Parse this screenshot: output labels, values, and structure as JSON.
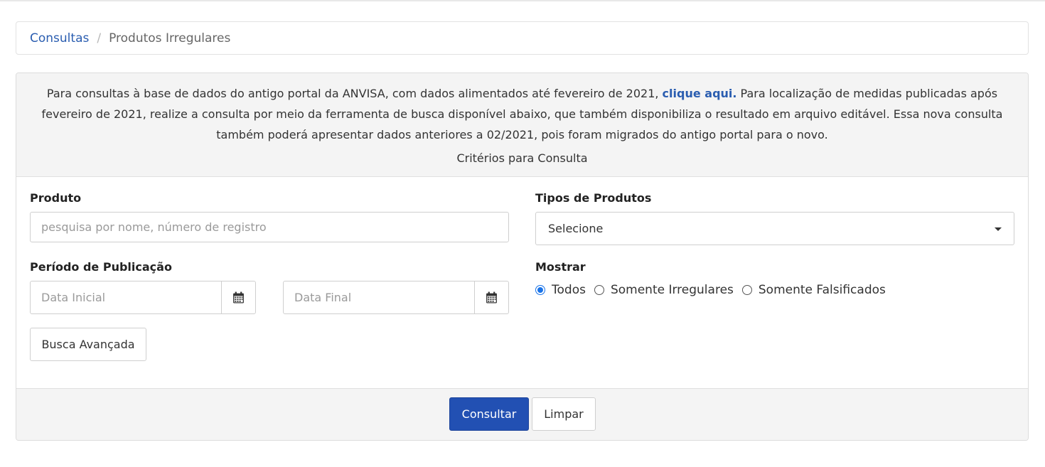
{
  "breadcrumb": {
    "link": "Consultas",
    "separator": "/",
    "current": "Produtos Irregulares"
  },
  "notice": {
    "text_before": "Para consultas à base de dados do antigo portal da ANVISA, com dados alimentados até fevereiro de 2021, ",
    "link_text": "clique aqui.",
    "text_after": " Para localização de medidas publicadas após fevereiro de 2021, realize a consulta por meio da ferramenta de busca disponível abaixo, que também disponibiliza o resultado em arquivo editável. Essa nova consulta também poderá apresentar dados anteriores a 02/2021, pois foram migrados do antigo portal para o novo."
  },
  "criteria_title": "Critérios para Consulta",
  "form": {
    "produto_label": "Produto",
    "produto_placeholder": "pesquisa por nome, número de registro",
    "tipos_label": "Tipos de Produtos",
    "tipos_selected": "Selecione",
    "periodo_label": "Período de Publicação",
    "data_inicial_placeholder": "Data Inicial",
    "data_final_placeholder": "Data Final",
    "mostrar_label": "Mostrar",
    "mostrar_options": [
      "Todos",
      "Somente Irregulares",
      "Somente Falsificados"
    ],
    "mostrar_selected_index": 0,
    "busca_avancada": "Busca Avançada"
  },
  "actions": {
    "consultar": "Consultar",
    "limpar": "Limpar"
  },
  "colors": {
    "link": "#2a5db0",
    "primary": "#2250b3",
    "radio_checked": "#1a73e8"
  }
}
